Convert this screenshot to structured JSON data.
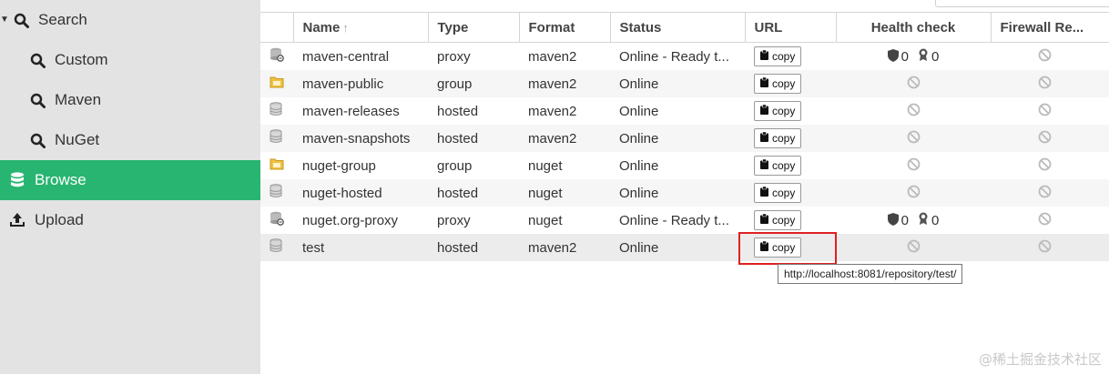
{
  "sidebar": {
    "items": [
      {
        "label": "Search",
        "icon": "search-icon"
      },
      {
        "label": "Custom",
        "icon": "search-icon"
      },
      {
        "label": "Maven",
        "icon": "search-icon"
      },
      {
        "label": "NuGet",
        "icon": "search-icon"
      },
      {
        "label": "Browse",
        "icon": "database-icon",
        "active": true
      },
      {
        "label": "Upload",
        "icon": "upload-icon"
      }
    ]
  },
  "table": {
    "columns": [
      "Name",
      "Type",
      "Format",
      "Status",
      "URL",
      "Health check",
      "Firewall Re..."
    ],
    "copy_label": "copy",
    "rows": [
      {
        "name": "maven-central",
        "type": "proxy",
        "format": "maven2",
        "status": "Online - Ready t...",
        "health": {
          "shield": "0",
          "award": "0"
        }
      },
      {
        "name": "maven-public",
        "type": "group",
        "format": "maven2",
        "status": "Online"
      },
      {
        "name": "maven-releases",
        "type": "hosted",
        "format": "maven2",
        "status": "Online"
      },
      {
        "name": "maven-snapshots",
        "type": "hosted",
        "format": "maven2",
        "status": "Online"
      },
      {
        "name": "nuget-group",
        "type": "group",
        "format": "nuget",
        "status": "Online"
      },
      {
        "name": "nuget-hosted",
        "type": "hosted",
        "format": "nuget",
        "status": "Online"
      },
      {
        "name": "nuget.org-proxy",
        "type": "proxy",
        "format": "nuget",
        "status": "Online - Ready t...",
        "health": {
          "shield": "0",
          "award": "0"
        }
      },
      {
        "name": "test",
        "type": "hosted",
        "format": "maven2",
        "status": "Online"
      }
    ]
  },
  "tooltip": "http://localhost:8081/repository/test/",
  "watermark": "@稀土掘金技术社区",
  "colors": {
    "accent": "#28b571",
    "highlight": "#e02020"
  }
}
